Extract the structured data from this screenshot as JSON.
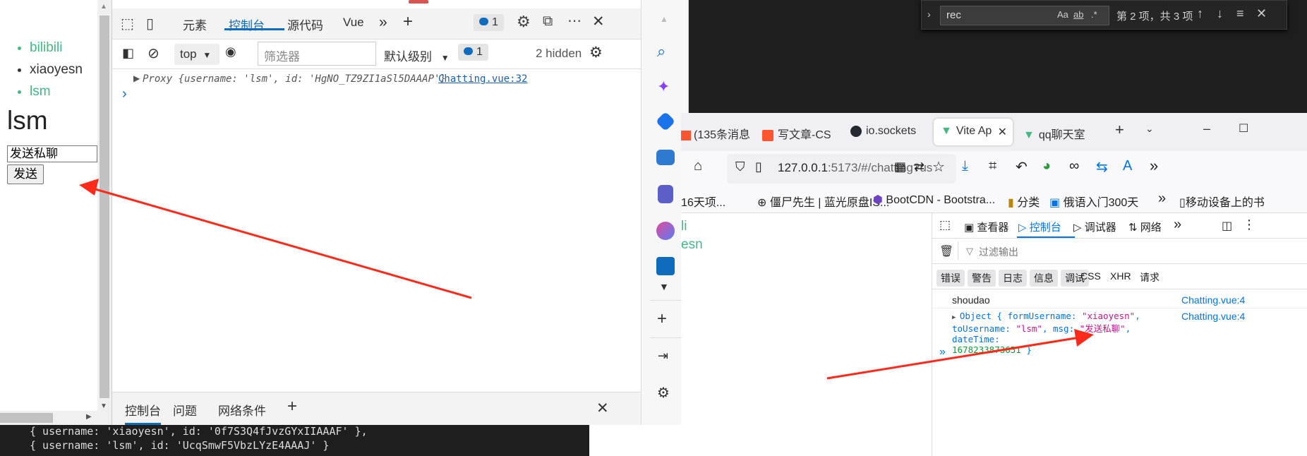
{
  "find_bar": {
    "query": "rec",
    "options": [
      "Aa",
      "ab",
      ".*"
    ],
    "match_count": "第 2 项，共 3 项"
  },
  "left_page": {
    "users": [
      {
        "name": "bilibili",
        "green": true
      },
      {
        "name": "xiaoyesn",
        "green": false
      },
      {
        "name": "lsm",
        "green": true
      }
    ],
    "current_user": "lsm",
    "message_value": "发送私聊",
    "send_label": "发送"
  },
  "edge_devtools": {
    "tabs": [
      "元素",
      "控制台",
      "源代码",
      "Vue"
    ],
    "active_tab": "控制台",
    "message_count": "1",
    "toolbar": {
      "context": "top",
      "filter_placeholder": "筛选器",
      "level": "默认级别",
      "issues_count": "1",
      "hidden": "2 hidden"
    },
    "log": {
      "text": "Proxy {username: 'lsm', id: 'HgNO_TZ9ZI1aSl5DAAAP'}",
      "source": "Chatting.vue:32"
    },
    "prompt": "›",
    "drawer_tabs": [
      "控制台",
      "问题",
      "网络条件"
    ]
  },
  "terminal": {
    "lines": [
      "{ username: 'xiaoyesn', id: '0f7S3Q4fJvzGYxIIAAAF' },",
      "{ username: 'lsm', id: 'UcqSmwF5VbzLYzE4AAAJ' }"
    ]
  },
  "firefox": {
    "tabs": [
      {
        "label": "(135条消息",
        "icon": "csdn"
      },
      {
        "label": "写文章-CS",
        "icon": "csdn"
      },
      {
        "label": "io.sockets",
        "icon": "github"
      },
      {
        "label": "Vite Ap",
        "icon": "vue",
        "active": true
      },
      {
        "label": "qq聊天室",
        "icon": "vue"
      }
    ],
    "url_host": "127.0.0.1",
    "url_rest": ":5173/#/chatting?user",
    "bookmarks": [
      "16天项...",
      "僵尸先生 | 蓝光原盘IS...",
      "BootCDN - Bootstra...",
      "分类",
      "俄语入门300天",
      "移动设备上的书"
    ],
    "page_users": [
      "li",
      "esn"
    ],
    "devtools": {
      "tabs": [
        "查看器",
        "控制台",
        "调试器",
        "网络"
      ],
      "active_tab": "控制台",
      "filter_placeholder": "过滤输出",
      "levels": [
        "错误",
        "警告",
        "日志",
        "信息",
        "调试"
      ],
      "extra_filters": [
        "CSS",
        "XHR",
        "请求"
      ],
      "logs": [
        {
          "text": "shoudao",
          "source": "Chatting.vue:4"
        },
        {
          "prefix": "Object { formUsername: ",
          "formUsername": "\"xiaoyesn\"",
          "toUsername_key": "toUsername: ",
          "toUsername": "\"lsm\"",
          "msg_key": ", msg: ",
          "msg": "\"发送私聊\"",
          "dateTime_key": ", dateTime:",
          "dateTime": "1678233873651",
          "suffix": " }",
          "source": "Chatting.vue:4"
        }
      ]
    }
  },
  "colors": {
    "vue_green": "#42b983",
    "edge_blue": "#0f6cbd",
    "arrow_red": "#ff2a1a"
  }
}
